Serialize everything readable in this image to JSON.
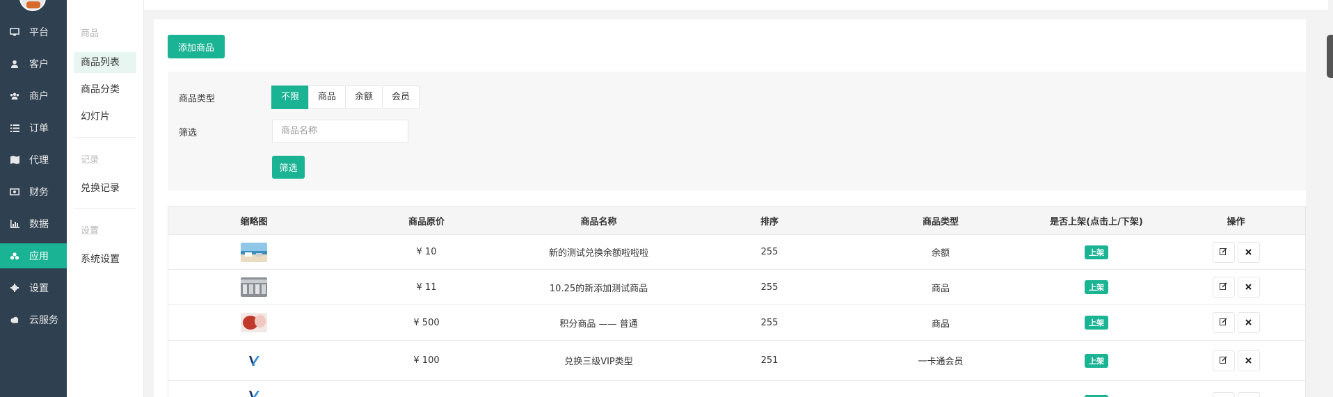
{
  "nav": {
    "items": [
      {
        "label": "平台",
        "icon": "desktop-icon"
      },
      {
        "label": "客户",
        "icon": "user-icon"
      },
      {
        "label": "商户",
        "icon": "users-icon"
      },
      {
        "label": "订单",
        "icon": "list-icon"
      },
      {
        "label": "代理",
        "icon": "map-icon"
      },
      {
        "label": "财务",
        "icon": "money-icon"
      },
      {
        "label": "数据",
        "icon": "bar-chart-icon"
      },
      {
        "label": "应用",
        "icon": "cubes-icon",
        "active": true
      },
      {
        "label": "设置",
        "icon": "gear-icon"
      },
      {
        "label": "云服务",
        "icon": "cloud-icon"
      }
    ]
  },
  "subnav": {
    "group1": {
      "header": "商品",
      "items": [
        "商品列表",
        "商品分类",
        "幻灯片"
      ]
    },
    "group2": {
      "header": "记录",
      "items": [
        "兑换记录"
      ]
    },
    "group3": {
      "header": "设置",
      "items": [
        "系统设置"
      ]
    }
  },
  "toolbar": {
    "add_label": "添加商品"
  },
  "filter": {
    "type_label": "商品类型",
    "type_options": [
      "不限",
      "商品",
      "余额",
      "会员"
    ],
    "type_selected": "不限",
    "search_label": "筛选",
    "search_placeholder": "商品名称",
    "search_value": "",
    "submit_label": "筛选"
  },
  "table": {
    "headers": [
      "缩略图",
      "商品原价",
      "商品名称",
      "排序",
      "商品类型",
      "是否上架(点击上/下架)",
      "操作"
    ],
    "rows": [
      {
        "thumb": "beach-photo",
        "price": "¥ 10",
        "name": "新的测试兑换余额啦啦啦",
        "sort": "255",
        "type": "余额",
        "status": "上架"
      },
      {
        "thumb": "shop-photo",
        "price": "¥ 11",
        "name": "10.25的新添加测试商品",
        "sort": "255",
        "type": "商品",
        "status": "上架"
      },
      {
        "thumb": "red-photo",
        "price": "¥ 500",
        "name": "积分商品 —— 普通",
        "sort": "255",
        "type": "商品",
        "status": "上架"
      },
      {
        "thumb": "vip-logo",
        "price": "¥ 100",
        "name": "兑换三级VIP类型",
        "sort": "251",
        "type": "一卡通会员",
        "status": "上架"
      },
      {
        "thumb": "vip-logo",
        "price": "",
        "name": "",
        "sort": "",
        "type": "",
        "status": "上架"
      }
    ],
    "edit_icon": "edit-icon",
    "delete_icon": "close-icon"
  },
  "colors": {
    "accent": "#1ab394",
    "sidebar": "#2f4050"
  }
}
